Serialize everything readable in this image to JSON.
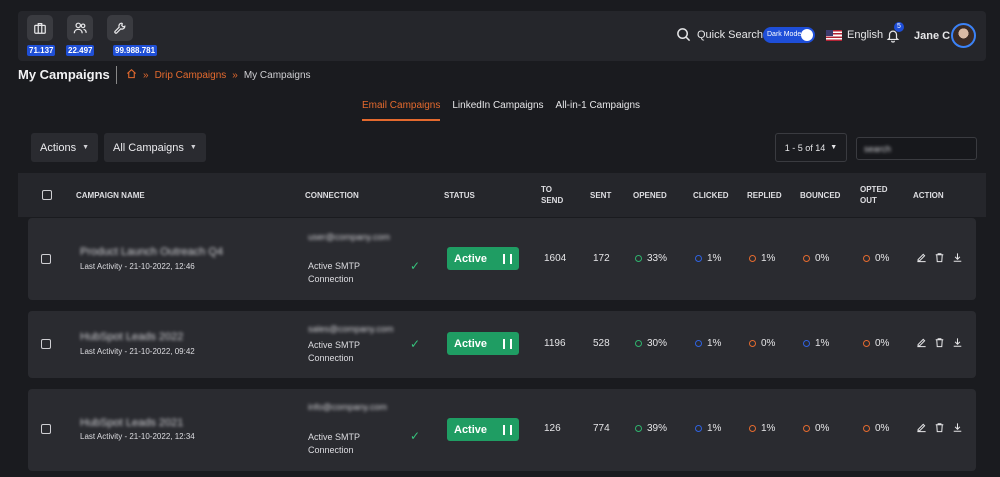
{
  "header": {
    "stats": [
      {
        "icon": "briefcase-icon",
        "value": "71.137"
      },
      {
        "icon": "users-icon",
        "value": "22.497"
      },
      {
        "icon": "wrench-icon",
        "value": "99.988.781"
      }
    ],
    "quick_search": "Quick Search",
    "dark_mode_label": "Dark Mode",
    "language": "English",
    "notifications": "5",
    "user": "Jane C"
  },
  "page": {
    "title": "My Campaigns",
    "breadcrumb": {
      "link": "Drip Campaigns",
      "current": "My Campaigns"
    }
  },
  "tabs": [
    "Email Campaigns",
    "LinkedIn Campaigns",
    "All-in-1 Campaigns"
  ],
  "toolbar": {
    "actions": "Actions",
    "filter": "All Campaigns",
    "pager": "1 - 5 of 14",
    "search_value": "search"
  },
  "table": {
    "headers": {
      "name": "CAMPAIGN NAME",
      "connection": "CONNECTION",
      "status": "STATUS",
      "to_send": "TO SEND",
      "sent": "SENT",
      "opened": "OPENED",
      "clicked": "CLICKED",
      "replied": "REPLIED",
      "bounced": "BOUNCED",
      "opted_out": "OPTED OUT",
      "action": "ACTION"
    },
    "rows": [
      {
        "name": "Product Launch Outreach Q4",
        "activity": "Last Activity - 21-10-2022, 12:46",
        "conn_email": "user@company.com",
        "conn_status": "Active SMTP Connection",
        "status": "Active",
        "to_send": "1604",
        "sent": "172",
        "opened": "33%",
        "clicked": "1%",
        "replied": "1%",
        "bounced": "0%",
        "opted_out": "0%"
      },
      {
        "name": "HubSpot Leads 2022",
        "activity": "Last Activity - 21-10-2022, 09:42",
        "conn_email": "sales@company.com",
        "conn_status": "Active SMTP Connection",
        "status": "Active",
        "to_send": "1196",
        "sent": "528",
        "opened": "30%",
        "clicked": "1%",
        "replied": "0%",
        "bounced": "1%",
        "opted_out": "0%"
      },
      {
        "name": "HubSpot Leads 2021",
        "activity": "Last Activity - 21-10-2022, 12:34",
        "conn_email": "info@company.com",
        "conn_status": "Active SMTP Connection",
        "status": "Active",
        "to_send": "126",
        "sent": "774",
        "opened": "39%",
        "clicked": "1%",
        "replied": "1%",
        "bounced": "0%",
        "opted_out": "0%"
      }
    ]
  },
  "colors": {
    "accent": "#e46a2e",
    "active": "#1f9d63",
    "blue": "#1e4ed8",
    "green_dot": "#2fb36d",
    "orange_dot": "#e46a2e",
    "blue_dot": "#2f62e0"
  }
}
